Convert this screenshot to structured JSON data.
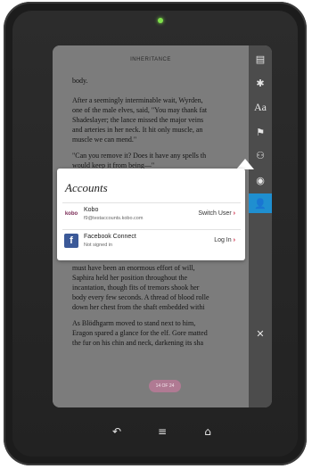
{
  "book": {
    "title": "INHERITANCE",
    "page_indicator": "14 OF 24",
    "paragraphs": [
      "body.",
      "After a seemingly interminable wait, Wyrden,\none of the male elves, said, \"You may thank fat\nShadeslayer; the lance missed the major veins\nand arteries in her neck. It hit only muscle, an\nmuscle we can mend.\"",
      "\"Can you remove it? Does it have any spells th\nwould keep it from being—\"",
      "must have been an enormous effort of will,\nSaphira held her position throughout the\nincantation, though fits of tremors shook her\nbody every few seconds. A thread of blood rolle\ndown her chest from the shaft embedded withi",
      "As Blödhgarm moved to stand next to him,\nEragon spared a glance for the elf. Gore matted\nthe fur on his chin and neck, darkening its sha"
    ]
  },
  "rail": {
    "icons": [
      "library-icon",
      "settings-icon",
      "font-icon",
      "bookmark-icon",
      "share-icon",
      "view-icon",
      "accounts-icon",
      "close-icon"
    ],
    "font_label": "Aa"
  },
  "accounts": {
    "title": "Accounts",
    "rows": [
      {
        "logo": "kobo",
        "name": "Kobo",
        "sub": "f9@testaccounts.kobo.com",
        "action": "Switch User"
      },
      {
        "logo": "f",
        "name": "Facebook Connect",
        "sub": "Not signed in",
        "action": "Log In"
      }
    ]
  },
  "navbar": {
    "icons": [
      "back-icon",
      "menu-icon",
      "home-icon"
    ]
  },
  "colors": {
    "accent": "#1f8fd0",
    "action_chevron": "#c8102e"
  }
}
